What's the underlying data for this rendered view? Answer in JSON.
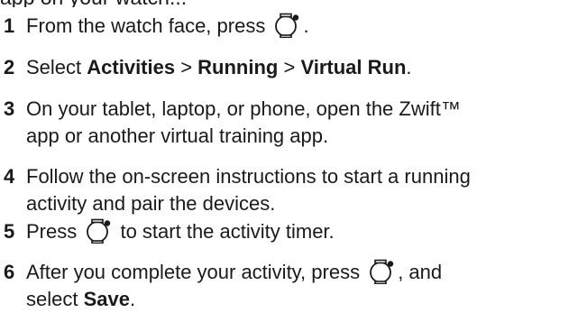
{
  "clipped_text": "app on your watch...",
  "icons": {
    "device_button": "watch-button-icon"
  },
  "steps": [
    {
      "number": "1",
      "line1_pre": "From the watch face, press ",
      "line1_post": "."
    },
    {
      "number": "2",
      "pre": "Select ",
      "b1": "Activities",
      "sep1": " > ",
      "b2": "Running",
      "sep2": " > ",
      "b3": "Virtual Run",
      "post": "."
    },
    {
      "number": "3",
      "line1": "On your tablet, laptop, or phone, open the Zwift™",
      "line2": "app or another virtual training app."
    },
    {
      "number": "4",
      "line1": "Follow the on-screen instructions to start a running",
      "line2": "activity and pair the devices."
    },
    {
      "number": "5",
      "pre": "Press ",
      "post": " to start the activity timer."
    },
    {
      "number": "6",
      "pre": "After you complete your activity, press ",
      "post": ", and",
      "line2_pre": "select ",
      "line2_bold": "Save",
      "line2_post": "."
    }
  ]
}
